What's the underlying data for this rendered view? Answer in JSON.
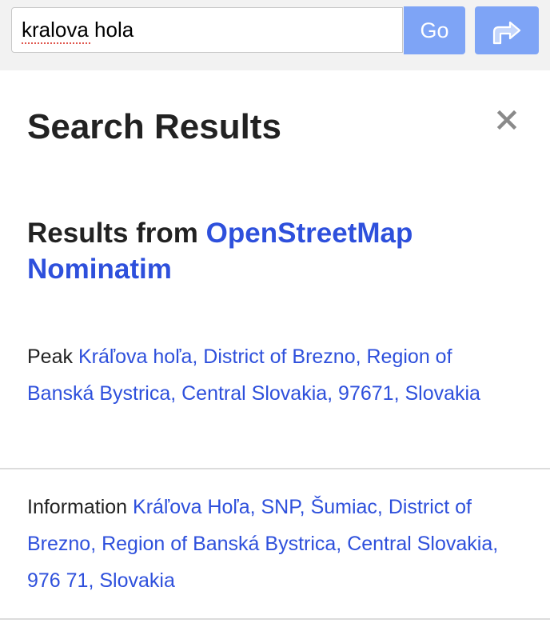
{
  "search": {
    "value": "kralova hola",
    "go_label": "Go",
    "directions_icon": "directions-turn-right-icon"
  },
  "panel": {
    "title": "Search Results",
    "close_icon": "close-icon",
    "results_heading_prefix": "Results from",
    "results_source_line1": "OpenStreetMap",
    "results_source_line2": "Nominatim"
  },
  "results": [
    {
      "type": "Peak",
      "name": "Kráľova hoľa, District of Brezno, Region of Banská Bystrica, Central Slovakia, 97671, Slovakia"
    },
    {
      "type": "Information",
      "name": "Kráľova Hoľa, SNP, Šumiac, District of Brezno, Region of Banská Bystrica, Central Slovakia, 976 71, Slovakia"
    }
  ],
  "colors": {
    "accent_button": "#7ea4f6",
    "link": "#2e50dc",
    "topbar_bg": "#f2f2f2"
  }
}
